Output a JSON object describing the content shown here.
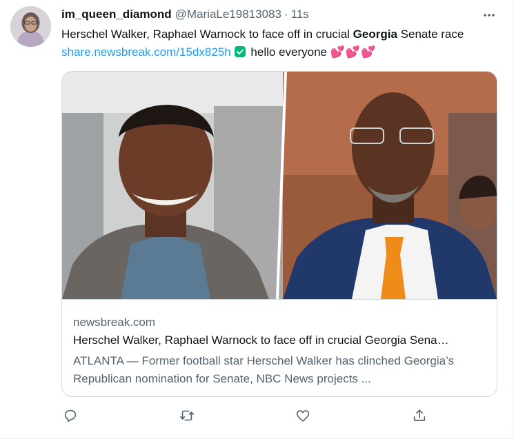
{
  "tweet": {
    "display_name": "im_queen_diamond",
    "handle": "@MariaLe19813083",
    "separator": "·",
    "time": "11s",
    "text": {
      "line1_a": "Herschel Walker, Raphael Warnock   to face off in crucial ",
      "bold": "Georgia",
      "line1_b": " Senate race ",
      "link": "share.newsbreak.com/15dx825h",
      "after": " hello everyone ",
      "hearts": "💕💕💕"
    }
  },
  "card": {
    "domain": "newsbreak.com",
    "title": "Herschel Walker, Raphael Warnock to face off in crucial Georgia Sena…",
    "description": "ATLANTA — Former football star Herschel Walker has clinched Georgia’s Republican nomination for Senate, NBC News projects ..."
  },
  "colors": {
    "accent": "#1d9bf0",
    "verified": "#00ba7c",
    "muted": "#536471",
    "border": "#cfd9de"
  },
  "icons": [
    "more-icon",
    "verified-icon",
    "reply-icon",
    "retweet-icon",
    "like-icon",
    "share-icon"
  ]
}
